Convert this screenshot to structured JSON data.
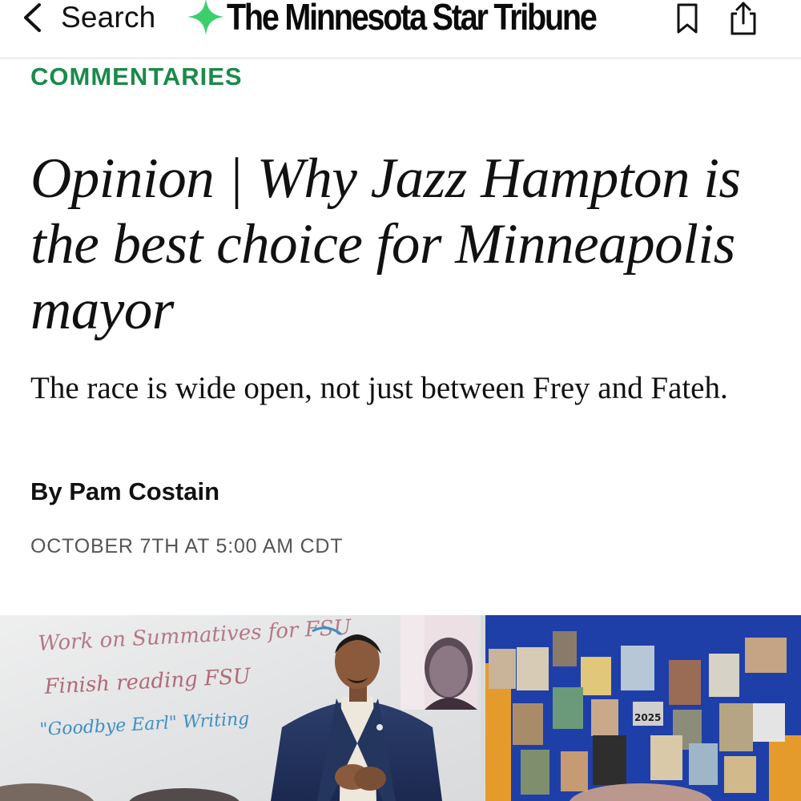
{
  "nav": {
    "back_label": "Search",
    "brand_name": "The Minnesota Star Tribune",
    "back_icon": "chevron-left-icon",
    "bookmark_icon": "bookmark-icon",
    "share_icon": "share-icon"
  },
  "article": {
    "section": "COMMENTARIES",
    "headline": "Opinion | Why Jazz Hampton is the best choice for Minneapolis mayor",
    "dek": "The race is wide open, not just between Frey and Fateh.",
    "byline_prefix": "By ",
    "author": "Pam Costain",
    "date": "OCTOBER 7TH AT 5:00 AM CDT"
  },
  "photo": {
    "whiteboard_lines": [
      "Work on Summatives for FSU",
      "Finish reading FSU",
      "\"Goodbye Earl\" Writing"
    ],
    "board_label": "2025"
  },
  "colors": {
    "accent_green": "#1b8a4a",
    "brand_star": "#3ccf6e",
    "text": "#111111",
    "muted": "#555555"
  }
}
